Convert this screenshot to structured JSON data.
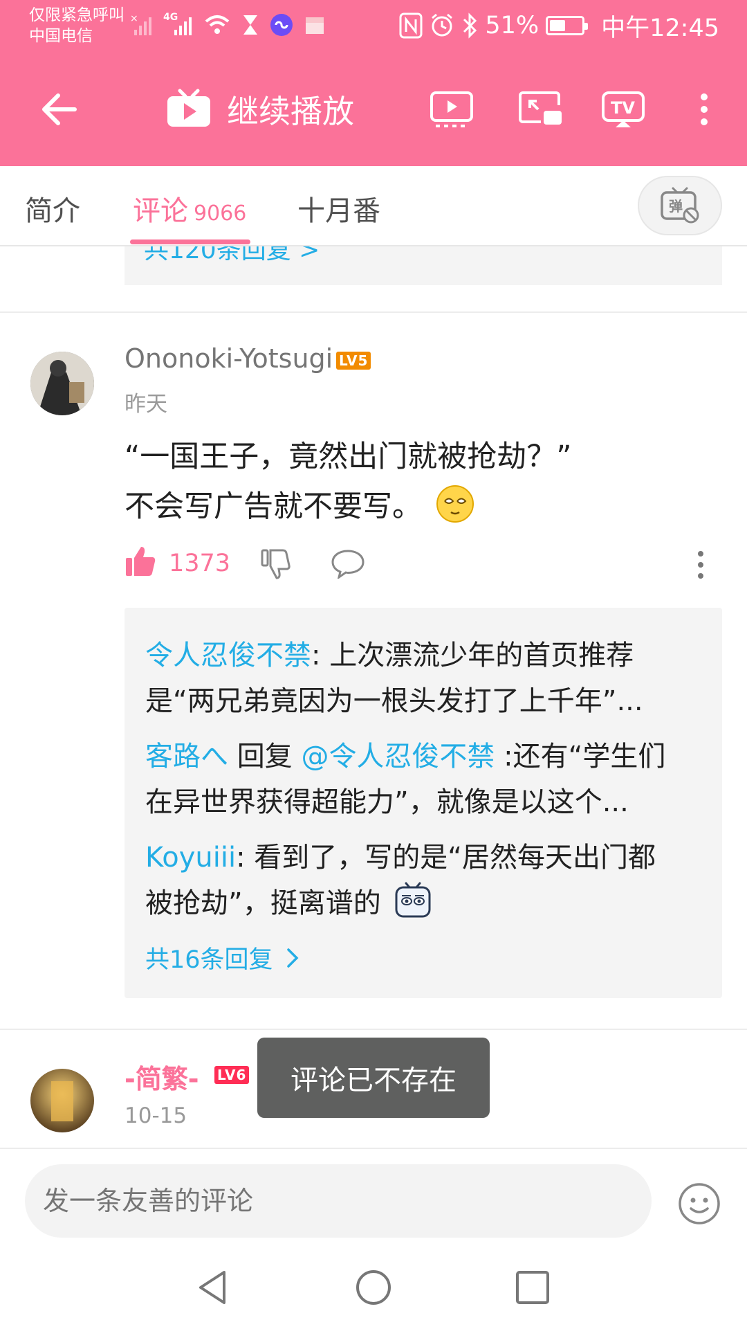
{
  "status_bar": {
    "carrier_line1": "仅限紧急呼叫",
    "carrier_line2": "中国电信",
    "network": "4G",
    "battery": "51%",
    "time": "中午12:45"
  },
  "app_bar": {
    "title": "继续播放"
  },
  "tabs": [
    {
      "label": "简介"
    },
    {
      "label": "评论",
      "count": "9066"
    },
    {
      "label": "十月番"
    }
  ],
  "danmu_toggle_icon": "danmu-off-icon",
  "prev_thread": {
    "more_replies": "共120条回复 >"
  },
  "comment": {
    "username": "Ononoki-Yotsugi",
    "level": "LV5",
    "date": "昨天",
    "line1": "“一国王子，竟然出门就被抢劫？”",
    "line2": "不会写广告就不要写。",
    "likes": "1373",
    "replies": [
      {
        "user": "令人忍俊不禁",
        "line1_rest": ": 上次漂流少年的首页推荐",
        "line2": "是“两兄弟竟因为一根头发打了上千年”..."
      },
      {
        "user": "客路へ",
        "reply_word": " 回复 ",
        "mention": "@令人忍俊不禁",
        "line1_rest": " :还有“学生们",
        "line2": "在异世界获得超能力”，就像是以这个..."
      },
      {
        "user": "Koyuiii",
        "line1_rest": ": 看到了，写的是“居然每天出门都",
        "line2": "被抢劫”，挺离谱的"
      }
    ],
    "total_replies": "共16条回复"
  },
  "comment2": {
    "username": "-简繁-",
    "level": "LV6",
    "date": "10-15"
  },
  "toast": "评论已不存在",
  "input": {
    "placeholder": "发一条友善的评论"
  },
  "colors": {
    "brand": "#fb7299",
    "link": "#23ade5",
    "lv5": "#f28b00",
    "lv6": "#ff2d55"
  }
}
